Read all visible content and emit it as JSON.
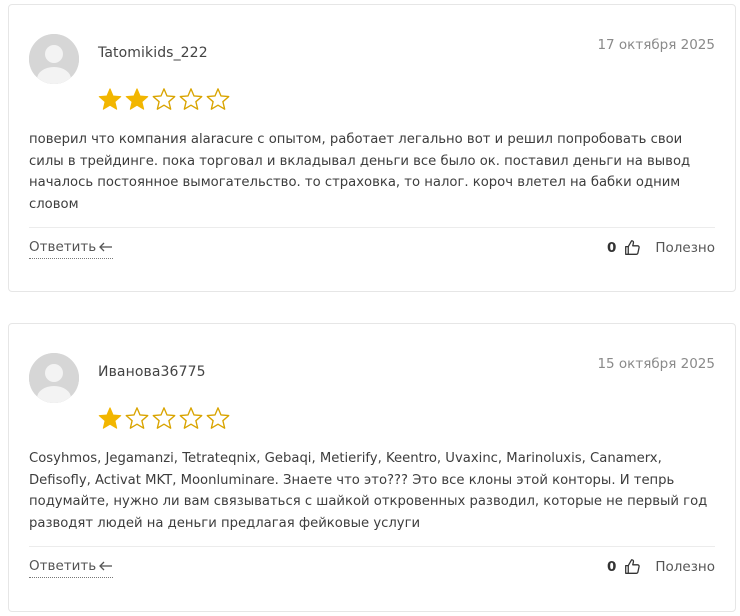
{
  "colors": {
    "star_filled": "#f2b600",
    "star_empty_stroke": "#d9a400",
    "avatar_bg": "#d6d6d6"
  },
  "reviews": [
    {
      "author": "Tatomikids_222",
      "date": "17 октября 2025",
      "rating": 2,
      "rating_max": 5,
      "text": "поверил что компания alaracure с опытом, работает легально вот и решил попробовать свои силы в трейдинге. пока торговал и вкладывал деньги все было ок. поставил деньги на вывод началось постоянное вымогательство. то страховка, то налог. короч влетел на бабки одним словом",
      "reply_label": "Ответить",
      "likes": "0",
      "useful_label": "Полезно"
    },
    {
      "author": "Иванова36775",
      "date": "15 октября 2025",
      "rating": 1,
      "rating_max": 5,
      "text": "Cosyhmos, Jegamanzi, Tetrateqnix, Gebaqi, Metierify, Keentro, Uvaxinc, Marinoluxis, Canamerx, Defisofly, Activat MKT, Moonluminare. Знаете что это??? Это все клоны этой конторы. И тепрь подумайте, нужно ли вам связываться с шайкой откровенных разводил, которые не первый год разводят людей на деньги предлагая фейковые услуги",
      "reply_label": "Ответить",
      "likes": "0",
      "useful_label": "Полезно"
    }
  ]
}
